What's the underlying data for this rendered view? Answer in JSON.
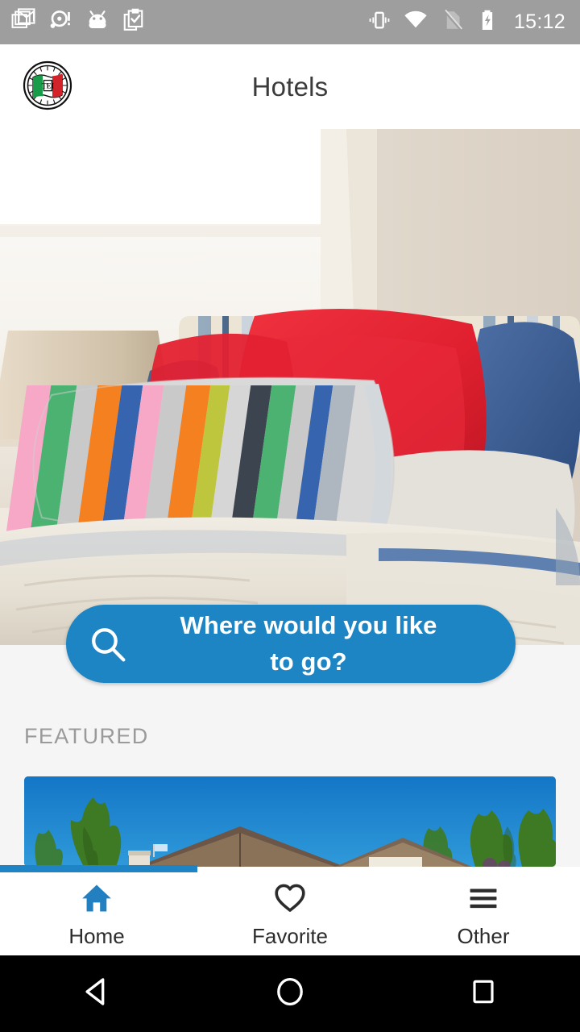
{
  "status_bar": {
    "background": "#9e9e9e",
    "time": "15:12",
    "left_icons": [
      {
        "name": "gmail-icon",
        "label": "Gmail"
      },
      {
        "name": "disc-alert-icon",
        "label": "Media alert"
      },
      {
        "name": "android-head-icon",
        "label": "Android"
      },
      {
        "name": "clipboard-check-icon",
        "label": "Tasks"
      }
    ],
    "right_icons": [
      {
        "name": "vibrate-icon",
        "label": "Vibrate"
      },
      {
        "name": "wifi-icon",
        "label": "Wi-Fi"
      },
      {
        "name": "no-sim-icon",
        "label": "No SIM"
      },
      {
        "name": "battery-charging-icon",
        "label": "Charging"
      }
    ]
  },
  "app_bar": {
    "title": "Hotels",
    "logo_name": "italian-flag-badge-logo",
    "title_color": "#3b3b3b",
    "background": "#ffffff"
  },
  "hero": {
    "name": "bedroom-hero-image",
    "alt": "Bed with red, blue and striped multicolor cushions"
  },
  "search": {
    "line1": "Where would you like",
    "line2": "to go?",
    "placeholder": "Where would you like to go?",
    "icon_name": "search-icon",
    "accent_color": "#1d85c4",
    "text_color": "#ffffff"
  },
  "featured": {
    "section_label": "FEATURED",
    "label_color": "#9a9a9a",
    "card": {
      "name": "featured-hotel-card",
      "alt": "Chalet roof against blue sky framed by green trees"
    }
  },
  "progress": {
    "name": "page-load-progress",
    "percent": 34,
    "color": "#1f84c6"
  },
  "bottom_nav": {
    "background": "#ffffff",
    "active_color": "#2380c0",
    "inactive_color": "#2c2c2c",
    "items": [
      {
        "label": "Home",
        "icon": "home-icon",
        "active": true
      },
      {
        "label": "Favorite",
        "icon": "heart-icon",
        "active": false
      },
      {
        "label": "Other",
        "icon": "hamburger-menu-icon",
        "active": false
      }
    ]
  },
  "android_nav": {
    "background": "#000000",
    "buttons": [
      {
        "name": "back-button",
        "icon": "triangle-back-icon"
      },
      {
        "name": "home-button",
        "icon": "circle-home-icon"
      },
      {
        "name": "recents-button",
        "icon": "square-recents-icon"
      }
    ]
  }
}
